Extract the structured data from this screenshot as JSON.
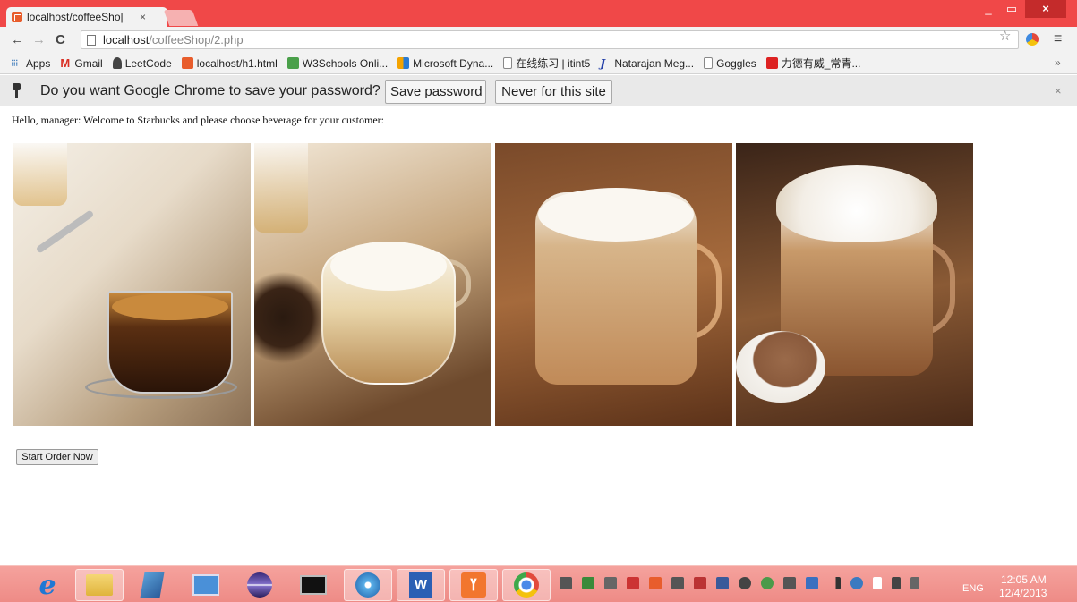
{
  "browser": {
    "tab_title": "localhost/coffeeSho|",
    "tab_close": "×",
    "url_host": "localhost",
    "url_path": "/coffeeShop/2.php",
    "window_controls": {
      "minimize": "_",
      "maximize": "▭",
      "close": "×"
    }
  },
  "bookmarks": [
    {
      "label": "Apps",
      "icon": "apps-grid-icon"
    },
    {
      "label": "Gmail",
      "icon": "gmail-icon"
    },
    {
      "label": "LeetCode",
      "icon": "person-icon"
    },
    {
      "label": "localhost/h1.html",
      "icon": "localhost-icon"
    },
    {
      "label": "W3Schools Onli...",
      "icon": "w3schools-icon"
    },
    {
      "label": "Microsoft Dyna...",
      "icon": "microsoft-icon"
    },
    {
      "label": "在线练习 | itint5",
      "icon": "page-icon"
    },
    {
      "label": "Natarajan Meg...",
      "icon": "j-icon"
    },
    {
      "label": "Goggles",
      "icon": "page-icon"
    },
    {
      "label": "力德有威_常青...",
      "icon": "red-logo-icon"
    }
  ],
  "bookmarks_overflow": "»",
  "infobar": {
    "message": "Do you want Google Chrome to save your password?",
    "save_label": "Save password",
    "never_label": "Never for this site",
    "close": "×"
  },
  "page": {
    "greeting": "Hello, manager: Welcome to Starbucks and please choose beverage for your customer:",
    "beverages": [
      {
        "icon": "espresso-photo"
      },
      {
        "icon": "latte-photo"
      },
      {
        "icon": "cappuccino-photo"
      },
      {
        "icon": "hot-chocolate-photo"
      }
    ],
    "start_button": "Start Order Now"
  },
  "taskbar": {
    "apps": [
      "internet-explorer-icon",
      "file-explorer-icon",
      "notes-icon",
      "screenshot-icon",
      "eclipse-icon",
      "command-prompt-icon",
      "media-disc-icon",
      "word-icon",
      "xampp-icon",
      "chrome-icon"
    ],
    "language": "ENG",
    "time": "12:05 AM",
    "date": "12/4/2013"
  },
  "colors": {
    "titlebar": "#f04848",
    "taskbar": "#ee8b86",
    "infobar": "#e9e9e9"
  }
}
